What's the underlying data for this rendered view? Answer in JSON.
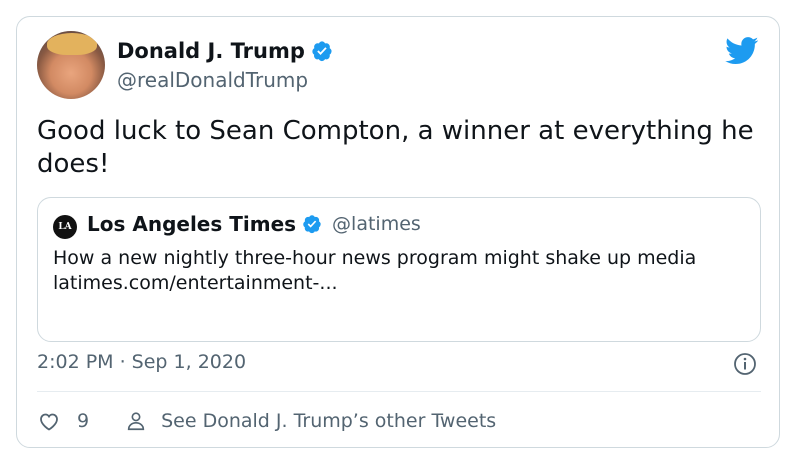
{
  "tweet": {
    "author": {
      "name": "Donald J. Trump",
      "handle": "@realDonaldTrump",
      "verified": true
    },
    "text": "Good luck to Sean Compton, a winner at everything he does!",
    "timestamp": "2:02 PM · Sep 1, 2020",
    "likes": "9",
    "see_more_label": "See Donald J. Trump’s other Tweets"
  },
  "quoted_tweet": {
    "logo_text": "LA Times",
    "name": "Los Angeles Times",
    "handle": "@latimes",
    "verified": true,
    "text": "How a new nightly three-hour news program might shake up media",
    "link": "latimes.com/entertainment-..."
  },
  "colors": {
    "accent": "#1d9bf0",
    "text_primary": "#0f1419",
    "text_secondary": "#536471",
    "border": "#cfd9de"
  },
  "icons": [
    "twitter-bird-icon",
    "verified-badge-icon",
    "info-icon",
    "heart-icon",
    "person-icon"
  ]
}
